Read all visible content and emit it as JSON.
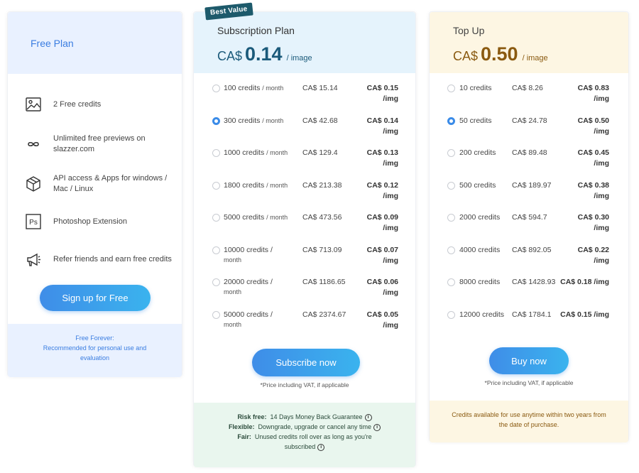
{
  "free": {
    "title": "Free Plan",
    "features": [
      {
        "icon": "image-icon",
        "text": "2 Free credits"
      },
      {
        "icon": "infinity-icon",
        "text": "Unlimited free previews on slazzer.com"
      },
      {
        "icon": "cube-icon",
        "text": "API access & Apps for windows / Mac / Linux"
      },
      {
        "icon": "photoshop-icon",
        "text": "Photoshop Extension"
      },
      {
        "icon": "megaphone-icon",
        "text": "Refer friends and earn free credits"
      }
    ],
    "button": "Sign up for Free",
    "foot_line1": "Free Forever:",
    "foot_line2": "Recommended for personal use and evaluation"
  },
  "subscription": {
    "badge": "Best Value",
    "title": "Subscription Plan",
    "currency": "CA$",
    "price": "0.14",
    "unit": "/ image",
    "selected_index": 1,
    "rows": [
      {
        "credits": "100 credits",
        "period": "/ month",
        "price": "CA$ 15.14",
        "per_img": "CA$ 0.15",
        "per_img2": "/img"
      },
      {
        "credits": "300 credits",
        "period": "/ month",
        "price": "CA$ 42.68",
        "per_img": "CA$ 0.14",
        "per_img2": "/img"
      },
      {
        "credits": "1000 credits",
        "period": "/ month",
        "price": "CA$ 129.4",
        "per_img": "CA$ 0.13",
        "per_img2": "/img"
      },
      {
        "credits": "1800 credits",
        "period": "/ month",
        "price": "CA$ 213.38",
        "per_img": "CA$ 0.12",
        "per_img2": "/img"
      },
      {
        "credits": "5000 credits",
        "period": "/ month",
        "price": "CA$ 473.56",
        "per_img": "CA$ 0.09",
        "per_img2": "/img"
      },
      {
        "credits": "10000 credits /",
        "period": "month",
        "price": "CA$ 713.09",
        "per_img": "CA$ 0.07",
        "per_img2": "/img"
      },
      {
        "credits": "20000 credits /",
        "period": "month",
        "price": "CA$ 1186.65",
        "per_img": "CA$ 0.06",
        "per_img2": "/img"
      },
      {
        "credits": "50000 credits /",
        "period": "month",
        "price": "CA$ 2374.67",
        "per_img": "CA$ 0.05",
        "per_img2": "/img"
      }
    ],
    "button": "Subscribe now",
    "note": "*Price including VAT, if applicable",
    "foot": [
      {
        "label": "Risk free:",
        "text": "14 Days Money Back Guarantee"
      },
      {
        "label": "Flexible:",
        "text": "Downgrade, upgrade or cancel any time"
      },
      {
        "label": "Fair:",
        "text": "Unused credits roll over as long as you're subscribed"
      }
    ]
  },
  "topup": {
    "title": "Top Up",
    "currency": "CA$",
    "price": "0.50",
    "unit": "/ image",
    "selected_index": 1,
    "rows": [
      {
        "credits": "10 credits",
        "price": "CA$ 8.26",
        "per_img": "CA$ 0.83",
        "per_img2": "/img"
      },
      {
        "credits": "50 credits",
        "price": "CA$ 24.78",
        "per_img": "CA$ 0.50",
        "per_img2": "/img"
      },
      {
        "credits": "200 credits",
        "price": "CA$ 89.48",
        "per_img": "CA$ 0.45",
        "per_img2": "/img"
      },
      {
        "credits": "500 credits",
        "price": "CA$ 189.97",
        "per_img": "CA$ 0.38",
        "per_img2": "/img"
      },
      {
        "credits": "2000 credits",
        "price": "CA$ 594.7",
        "per_img": "CA$ 0.30",
        "per_img2": "/img"
      },
      {
        "credits": "4000 credits",
        "price": "CA$ 892.05",
        "per_img": "CA$ 0.22",
        "per_img2": "/img"
      },
      {
        "credits": "8000 credits",
        "price": "CA$ 1428.93",
        "per_img": "CA$ 0.18 /img",
        "per_img2": ""
      },
      {
        "credits": "12000 credits",
        "price": "CA$ 1784.1",
        "per_img": "CA$ 0.15 /img",
        "per_img2": ""
      }
    ],
    "button": "Buy now",
    "note": "*Price including VAT, if applicable",
    "foot": "Credits available for use anytime within two years from the date of purchase."
  }
}
